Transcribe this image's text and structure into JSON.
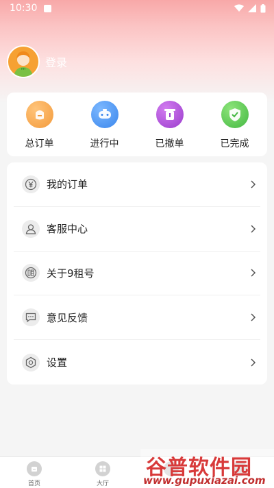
{
  "status_bar": {
    "time": "10:30"
  },
  "profile": {
    "login_label": "登录"
  },
  "orders": [
    {
      "label": "总订单",
      "icon": "bag-icon",
      "color": "#f5a04a"
    },
    {
      "label": "进行中",
      "icon": "gamepad-icon",
      "color": "#3f8ef0"
    },
    {
      "label": "已撤单",
      "icon": "trash-icon",
      "color": "#a847d6"
    },
    {
      "label": "已完成",
      "icon": "shield-check-icon",
      "color": "#4fc152"
    }
  ],
  "menu": [
    {
      "label": "我的订单",
      "icon": "yuan-icon"
    },
    {
      "label": "客服中心",
      "icon": "user-icon"
    },
    {
      "label": "关于9租号",
      "icon": "zu-icon"
    },
    {
      "label": "意见反馈",
      "icon": "chat-icon"
    },
    {
      "label": "设置",
      "icon": "settings-icon"
    }
  ],
  "bottom_nav": [
    {
      "label": "首页",
      "icon": "home-icon"
    },
    {
      "label": "大厅",
      "icon": "grid-icon"
    },
    {
      "label": "",
      "icon": ""
    },
    {
      "label": "",
      "icon": ""
    }
  ],
  "watermark": {
    "title": "谷普软件园",
    "url": "www.gupuxiazai.com"
  }
}
